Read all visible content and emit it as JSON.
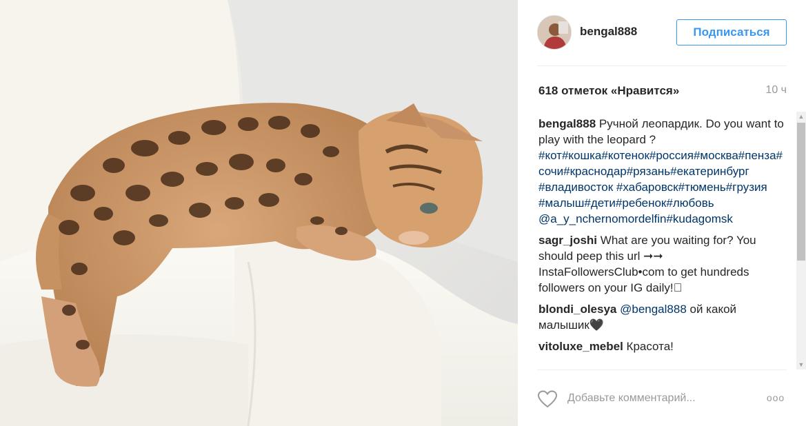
{
  "post": {
    "image_alt": "Bengal kitten on white sofa",
    "author": "bengal888",
    "follow_label": "Подписаться",
    "likes": "618 отметок «Нравится»",
    "time": "10 ч"
  },
  "comments": [
    {
      "user": "bengal888",
      "text": " Ручной леопардик. Do you want to play with the leopard ? ",
      "tags": "#кот#кошка#котенок#россия#москва#пенза#сочи#краснодар#рязань#екатеринбург #владивосток #хабаровск#тюмень#грузия #малыш#дети#ребенок#любовь",
      "mention": "@a_y_nchernomordelfin#kudagomsk"
    },
    {
      "user": "sagr_joshi",
      "text": " What are you waiting for? You should peep this url ➞➞ InstaFollowersClub•com to get hundreds followers on your IG daily!\u0000"
    },
    {
      "user": "blondi_olesya",
      "mention": "@bengal888",
      "text": " ой какой малышик🖤"
    },
    {
      "user": "vitoluxe_mebel",
      "text": " Красота!"
    }
  ],
  "footer": {
    "comment_placeholder": "Добавьте комментарий...",
    "more_label": "ooo"
  },
  "icons": {
    "like": "heart-outline-icon",
    "more": "ellipsis-icon"
  },
  "colors": {
    "accent": "#3897f0",
    "hashtag": "#003569",
    "muted": "#999999"
  }
}
